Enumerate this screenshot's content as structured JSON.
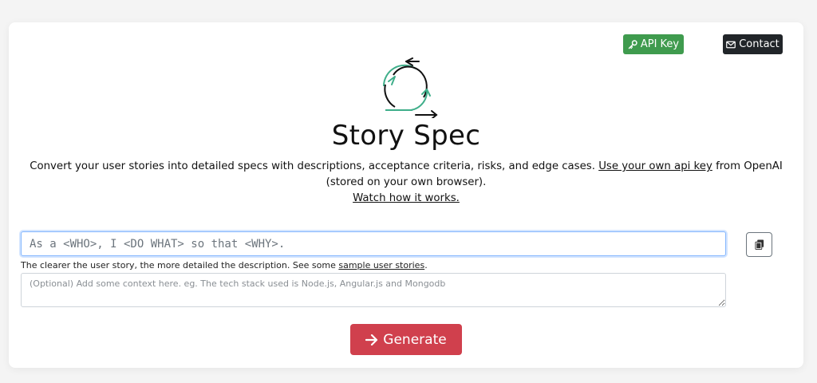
{
  "header": {
    "api_key_label": "API Key",
    "contact_label": "Contact"
  },
  "hero": {
    "title": "Story Spec",
    "description_text": "Convert your user stories into detailed specs with descriptions, acceptance criteria, risks, and edge cases.",
    "api_key_link": "Use your own api key",
    "from_text": "from OpenAI",
    "stored_text": "(stored on your own browser).",
    "watch_link": "Watch how it works."
  },
  "form": {
    "story_placeholder": "As a <WHO>, I <DO WHAT> so that <WHY>.",
    "hint_text": "The clearer the user story, the more detailed the description. See some",
    "hint_link": "sample user stories",
    "hint_end": ".",
    "context_placeholder": "(Optional) Add some context here. eg. The tech stack used is Node.js, Angular.js and Mongodb",
    "generate_label": "Generate"
  },
  "icons": {
    "api_key": "key-icon",
    "contact": "envelope-icon",
    "copy": "copy-icon",
    "generate": "arrow-right-icon",
    "logo": "cycle-arrows-logo"
  },
  "colors": {
    "api_key_button": "#3f9b4e",
    "contact_button": "#212529",
    "generate_button": "#d0404d",
    "logo_accent": "#3fae8a"
  }
}
